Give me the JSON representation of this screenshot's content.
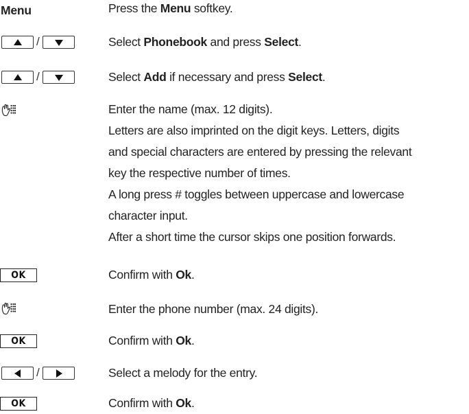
{
  "steps": [
    {
      "key_label": "Menu",
      "desc": {
        "p1": "Press the ",
        "b1": "Menu",
        "p2": " softkey."
      }
    },
    {
      "nav_separator": "/",
      "desc": {
        "p1": "Select ",
        "b1": "Phonebook",
        "p2": " and press ",
        "b2": "Select",
        "p3": "."
      }
    },
    {
      "nav_separator": "/",
      "desc": {
        "p1": "Select ",
        "b1": "Add",
        "p2": " if necessary and press ",
        "b2": "Select",
        "p3": "."
      }
    },
    {
      "desc_lines": [
        "Enter the name (max. 12 digits).",
        "Letters are also imprinted on the digit keys. Letters, digits",
        "and special characters are entered by pressing the relevant",
        "key the respective number of times.",
        "A long press # toggles between uppercase and lowercase",
        "character input.",
        "After a short time the cursor skips one position forwards."
      ]
    },
    {
      "ok_label": "OK",
      "desc": {
        "p1": "Confirm with ",
        "b1": "Ok",
        "p2": "."
      }
    },
    {
      "desc_text": "Enter the phone number (max. 24 digits)."
    },
    {
      "ok_label": "OK",
      "desc": {
        "p1": "Confirm with ",
        "b1": "Ok",
        "p2": "."
      }
    },
    {
      "nav_separator": "/",
      "desc_text": "Select a melody for the entry."
    },
    {
      "ok_label": "OK",
      "desc": {
        "p1": "Confirm with ",
        "b1": "Ok",
        "p2": "."
      }
    }
  ],
  "icons": {
    "up": "arrow-up-key-icon",
    "down": "arrow-down-key-icon",
    "left": "arrow-left-key-icon",
    "right": "arrow-right-key-icon",
    "keypad": "keypad-input-icon"
  }
}
